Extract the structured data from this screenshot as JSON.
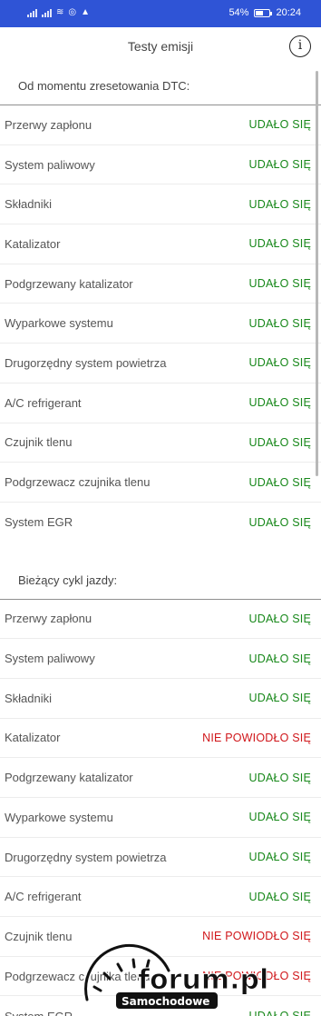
{
  "status_bar": {
    "battery_percent": "54%",
    "battery_level": 0.54,
    "time": "20:24",
    "icons": [
      "signal-icon",
      "signal-icon",
      "wifi-icon",
      "location-icon",
      "nav-icon"
    ]
  },
  "header": {
    "title": "Testy emisji",
    "info_label": "i"
  },
  "sections": [
    {
      "title": "Od momentu zresetowania DTC:",
      "rows": [
        {
          "label": "Przerwy zapłonu",
          "status": "UDAŁO SIĘ",
          "result": "ok"
        },
        {
          "label": "System paliwowy",
          "status": "UDAŁO SIĘ",
          "result": "ok"
        },
        {
          "label": "Składniki",
          "status": "UDAŁO SIĘ",
          "result": "ok"
        },
        {
          "label": "Katalizator",
          "status": "UDAŁO SIĘ",
          "result": "ok"
        },
        {
          "label": "Podgrzewany katalizator",
          "status": "UDAŁO SIĘ",
          "result": "ok"
        },
        {
          "label": "Wyparkowe systemu",
          "status": "UDAŁO SIĘ",
          "result": "ok"
        },
        {
          "label": "Drugorzędny system powietrza",
          "status": "UDAŁO SIĘ",
          "result": "ok"
        },
        {
          "label": "A/C refrigerant",
          "status": "UDAŁO SIĘ",
          "result": "ok"
        },
        {
          "label": "Czujnik tlenu",
          "status": "UDAŁO SIĘ",
          "result": "ok"
        },
        {
          "label": "Podgrzewacz czujnika tlenu",
          "status": "UDAŁO SIĘ",
          "result": "ok"
        },
        {
          "label": "System EGR",
          "status": "UDAŁO SIĘ",
          "result": "ok"
        }
      ]
    },
    {
      "title": "Bieżący cykl jazdy:",
      "rows": [
        {
          "label": "Przerwy zapłonu",
          "status": "UDAŁO SIĘ",
          "result": "ok"
        },
        {
          "label": "System paliwowy",
          "status": "UDAŁO SIĘ",
          "result": "ok"
        },
        {
          "label": "Składniki",
          "status": "UDAŁO SIĘ",
          "result": "ok"
        },
        {
          "label": "Katalizator",
          "status": "NIE POWIODŁO SIĘ",
          "result": "fail"
        },
        {
          "label": "Podgrzewany katalizator",
          "status": "UDAŁO SIĘ",
          "result": "ok"
        },
        {
          "label": "Wyparkowe systemu",
          "status": "UDAŁO SIĘ",
          "result": "ok"
        },
        {
          "label": "Drugorzędny system powietrza",
          "status": "UDAŁO SIĘ",
          "result": "ok"
        },
        {
          "label": "A/C refrigerant",
          "status": "UDAŁO SIĘ",
          "result": "ok"
        },
        {
          "label": "Czujnik tlenu",
          "status": "NIE POWIODŁO SIĘ",
          "result": "fail"
        },
        {
          "label": "Podgrzewacz czujnika tlenu",
          "status": "NIE POWIODŁO SIĘ",
          "result": "fail"
        },
        {
          "label": "System EGR",
          "status": "UDAŁO SIĘ",
          "result": "ok"
        }
      ]
    }
  ],
  "colors": {
    "status_bar": "#2f54d6",
    "ok": "#17881a",
    "fail": "#d0161a"
  },
  "watermark": {
    "brand": "forum.pl",
    "subtitle": "Samochodowe"
  }
}
